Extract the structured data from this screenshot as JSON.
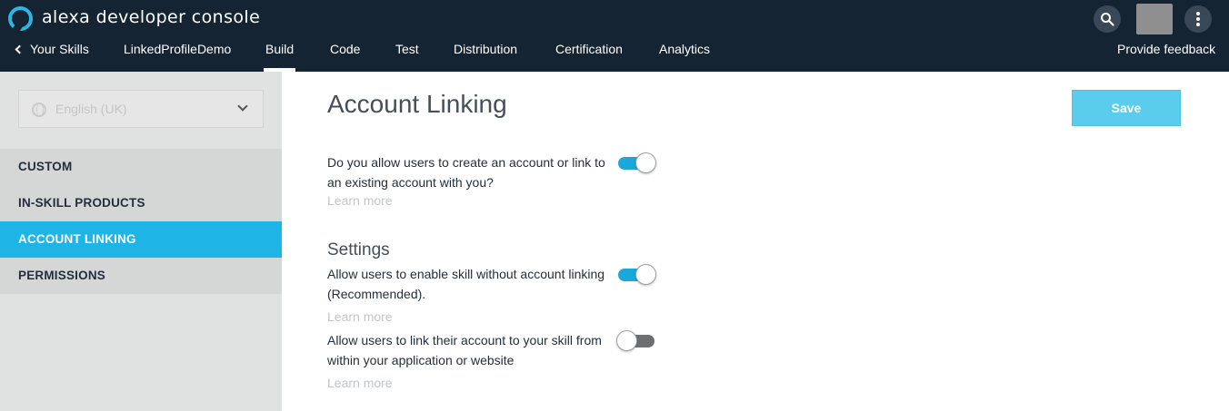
{
  "header": {
    "app_title": "alexa developer console",
    "nav": {
      "back_label": "Your Skills",
      "skill_name": "LinkedProfileDemo",
      "tabs": [
        "Build",
        "Code",
        "Test",
        "Distribution",
        "Certification",
        "Analytics"
      ],
      "active_tab": "Build",
      "feedback_label": "Provide feedback"
    },
    "icons": {
      "logo": "alexa-ring-icon",
      "search": "search-icon",
      "avatar": "avatar",
      "more": "more-vertical-icon"
    }
  },
  "sidebar": {
    "locale": "English (UK)",
    "items": [
      {
        "label": "CUSTOM",
        "active": false
      },
      {
        "label": "IN-SKILL PRODUCTS",
        "active": false
      },
      {
        "label": "ACCOUNT LINKING",
        "active": true
      },
      {
        "label": "PERMISSIONS",
        "active": false
      }
    ]
  },
  "main": {
    "title": "Account Linking",
    "save_label": "Save",
    "questions": [
      {
        "text": "Do you allow users to create an account or link to an existing account with you?",
        "learn_more": "Learn more",
        "enabled": true
      }
    ],
    "settings_title": "Settings",
    "settings": [
      {
        "text": "Allow users to enable skill without account linking (Recommended).",
        "learn_more": "Learn more",
        "enabled": true
      },
      {
        "text": "Allow users to link their account to your skill from within your application or website",
        "learn_more": "Learn more",
        "enabled": false
      }
    ]
  },
  "colors": {
    "topbar": "#142433",
    "accent": "#1eb4e6",
    "save_button": "#5bcdec",
    "toggle_on": "#1aa7dc",
    "toggle_off": "#6d6f73"
  }
}
